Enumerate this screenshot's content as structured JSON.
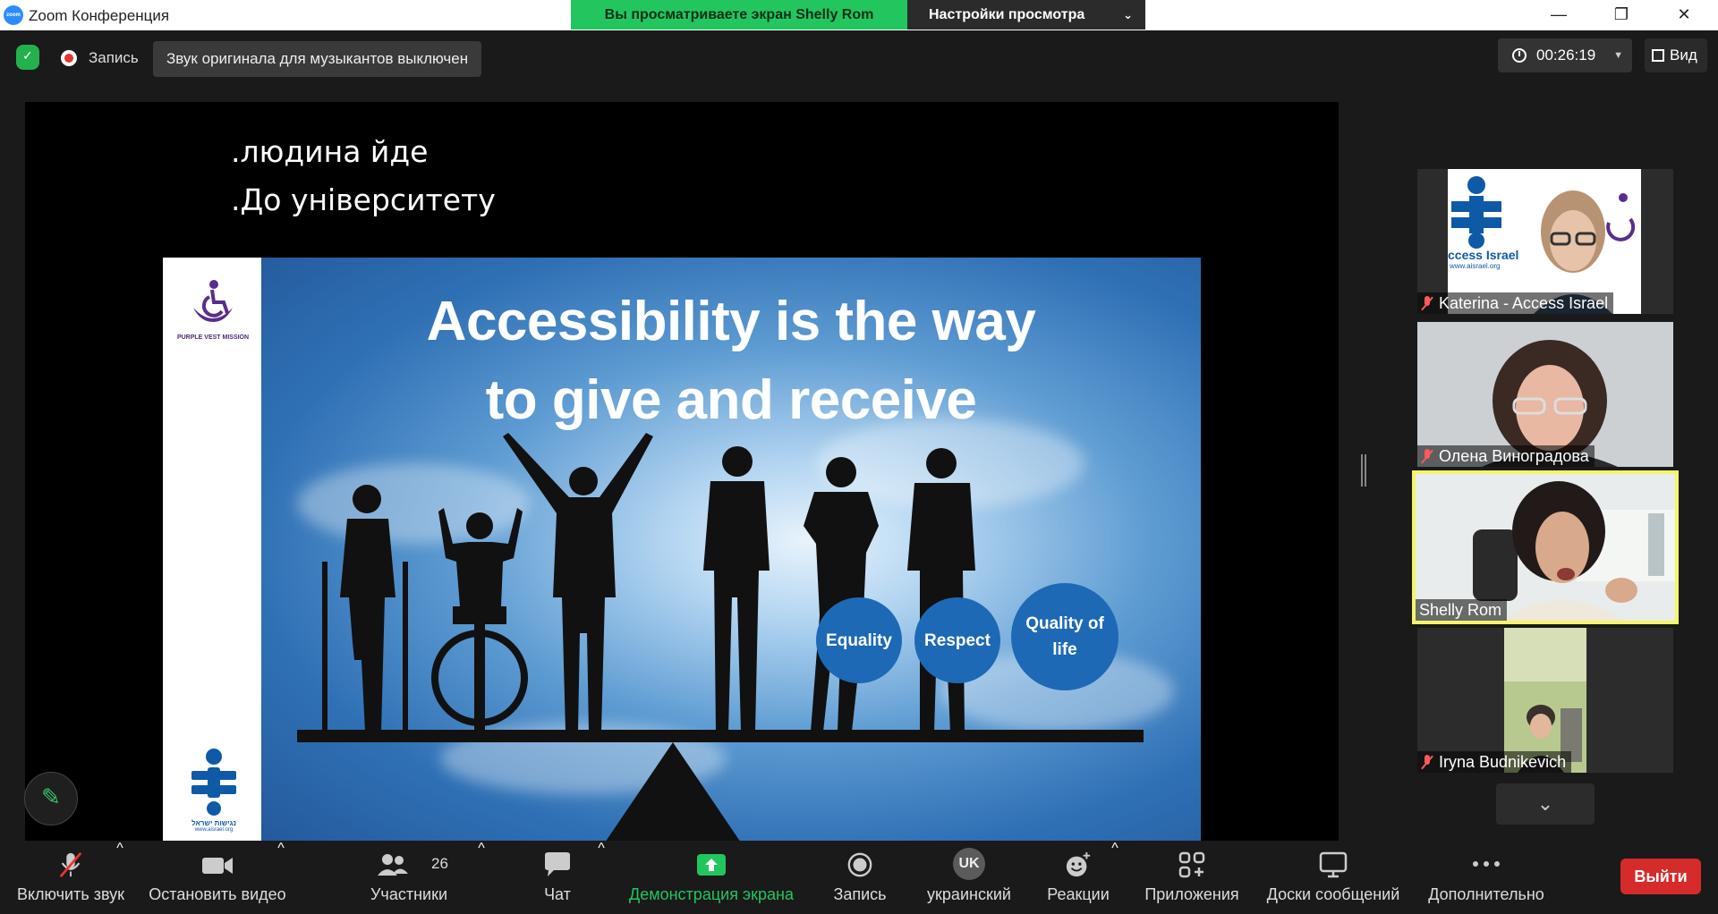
{
  "window": {
    "app_icon_text": "zoom",
    "title": "Zoom Конференция",
    "share_banner": "Вы просматриваете экран Shelly Rom",
    "view_options": "Настройки просмотра"
  },
  "topbar": {
    "recording_label": "Запись",
    "original_sound": "Звук оригинала для музыкантов выключен",
    "timer": "00:26:19",
    "view_label": "Вид"
  },
  "share": {
    "subtitle_lines": [
      ".людина йде",
      ".До університету"
    ],
    "slide": {
      "title_line1": "Accessibility is the way",
      "title_line2": "to give and receive",
      "circles": [
        "Equality",
        "Respect",
        "Quality of life"
      ],
      "logo_top_text": "PURPLE VEST MISSION",
      "logo_bottom_text": "נגישות ישראל",
      "logo_bottom_url": "www.aisrael.org",
      "ai_badge_text": "ccess Israel",
      "ai_badge_url": "www.aisrael.org"
    }
  },
  "participants": [
    {
      "name": "Katerina - Access Israel",
      "muted": true
    },
    {
      "name": "Олена Виноградова",
      "muted": true
    },
    {
      "name": "Shelly Rom",
      "muted": false,
      "speaking": true
    },
    {
      "name": "Iryna Budnikevich",
      "muted": true
    }
  ],
  "toolbar": {
    "unmute": "Включить звук",
    "stop_video": "Остановить видео",
    "participants": "Участники",
    "participants_count": "26",
    "chat": "Чат",
    "share_screen": "Демонстрация экрана",
    "record": "Запись",
    "language": "украинский",
    "language_code": "UK",
    "reactions": "Реакции",
    "apps": "Приложения",
    "whiteboards": "Доски сообщений",
    "more": "Дополнительно",
    "leave": "Выйти"
  },
  "colors": {
    "share_green": "#22c55e",
    "speaking_border": "#f5f56a",
    "leave_red": "#d62b2b",
    "circle_blue": "#1e69b5"
  }
}
